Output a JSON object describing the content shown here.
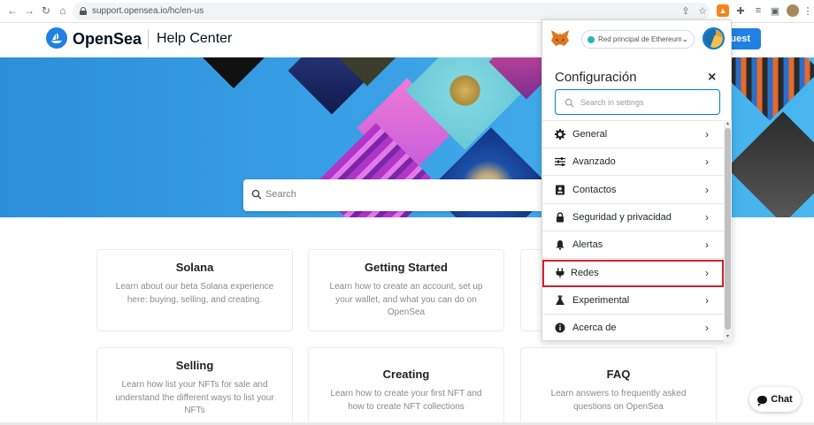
{
  "browser": {
    "url": "support.opensea.io/hc/en-us"
  },
  "header": {
    "brand": "OpenSea",
    "section": "Help Center",
    "request_label": "uest"
  },
  "hero": {
    "search_placeholder": "Search"
  },
  "cards": [
    {
      "title": "Solana",
      "description": "Learn about our beta Solana experience here: buying, selling, and creating."
    },
    {
      "title": "Getting Started",
      "description": "Learn how to create an account, set up your wallet, and what you can do on OpenSea"
    },
    {
      "title": "Selling",
      "description": "Learn how list your NFTs for sale and understand the different ways to list your NFTs"
    },
    {
      "title": "Creating",
      "description": "Learn how to create your first NFT and how to create NFT collections"
    },
    {
      "title": "FAQ",
      "description": "Learn answers to frequently asked questions on OpenSea"
    }
  ],
  "chat": {
    "label": "Chat"
  },
  "metamask": {
    "network": "Red principal de Ethereum",
    "title": "Configuración",
    "close": "×",
    "search_placeholder": "Search in settings",
    "items": [
      {
        "label": "General",
        "icon": "gear-icon"
      },
      {
        "label": "Avanzado",
        "icon": "sliders-icon"
      },
      {
        "label": "Contactos",
        "icon": "contact-book-icon"
      },
      {
        "label": "Seguridad y privacidad",
        "icon": "lock-icon"
      },
      {
        "label": "Alertas",
        "icon": "bell-icon"
      },
      {
        "label": "Redes",
        "icon": "plug-icon"
      },
      {
        "label": "Experimental",
        "icon": "flask-icon"
      },
      {
        "label": "Acerca de",
        "icon": "info-icon"
      }
    ],
    "highlighted_item": "Redes",
    "accent_color": "#037dd6",
    "highlight_color": "#d51f2b"
  },
  "colors": {
    "opensea_blue": "#2081e2"
  }
}
